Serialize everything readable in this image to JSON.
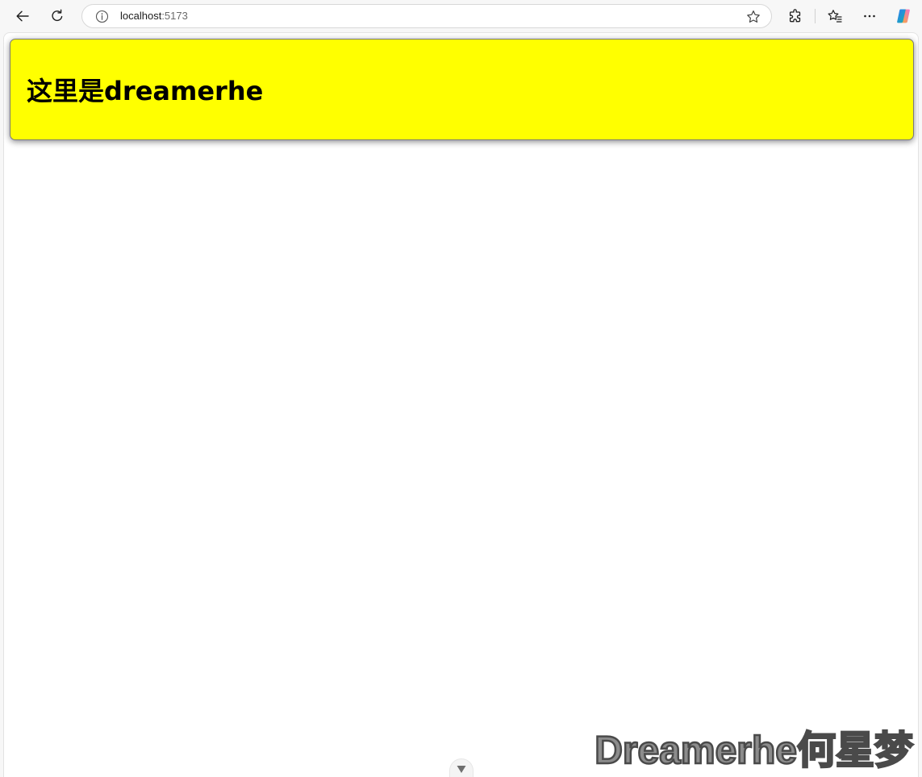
{
  "browser": {
    "url_host": "localhost",
    "url_port": ":5173",
    "icons": {
      "back": "back-arrow-icon",
      "reload": "reload-icon",
      "info": "info-icon",
      "favorite": "star-icon",
      "extensions": "extensions-icon",
      "favorites": "favorites-icon",
      "more": "more-icon",
      "copilot": "copilot-icon"
    }
  },
  "page": {
    "heading": "这里是dreamerhe",
    "box_color": "#ffff00"
  },
  "watermark": {
    "text": "Dreamerhe何星梦"
  }
}
